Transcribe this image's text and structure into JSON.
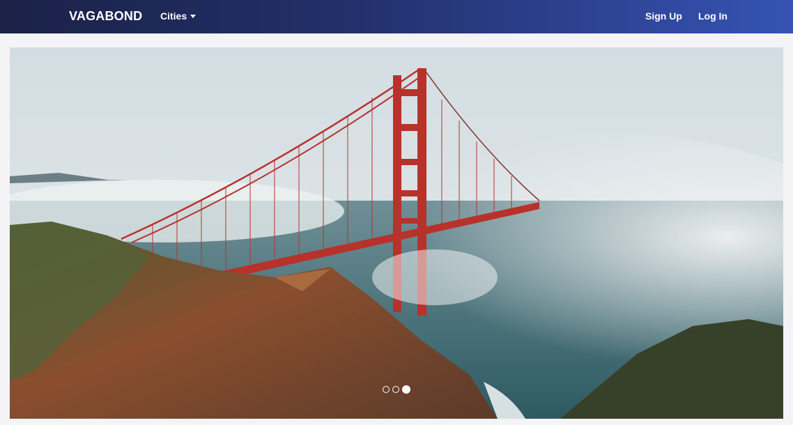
{
  "navbar": {
    "brand": "VAGABOND",
    "cities_label": "Cities",
    "signup_label": "Sign Up",
    "login_label": "Log In"
  },
  "carousel": {
    "slide_description_icon": "golden-gate-bridge-photo",
    "slide_count": 3,
    "active_slide": 3
  },
  "colors": {
    "nav_start": "#1a2247",
    "nav_end": "#3653b4",
    "bridge": "#b8322c"
  }
}
